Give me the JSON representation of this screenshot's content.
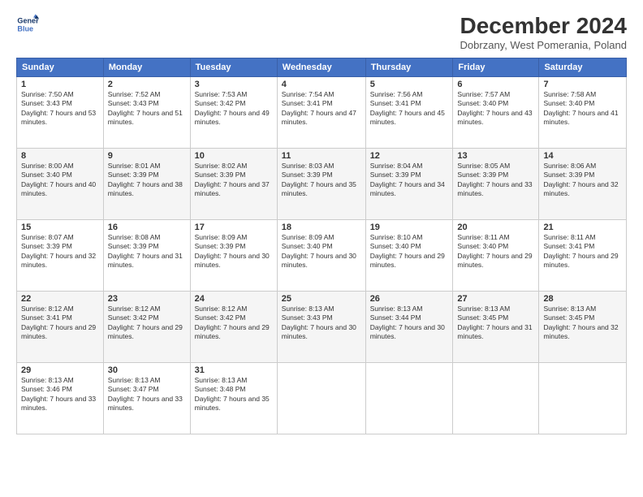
{
  "header": {
    "logo_line1": "General",
    "logo_line2": "Blue",
    "title": "December 2024",
    "subtitle": "Dobrzany, West Pomerania, Poland"
  },
  "columns": [
    "Sunday",
    "Monday",
    "Tuesday",
    "Wednesday",
    "Thursday",
    "Friday",
    "Saturday"
  ],
  "weeks": [
    [
      {
        "day": "1",
        "sunrise": "Sunrise: 7:50 AM",
        "sunset": "Sunset: 3:43 PM",
        "daylight": "Daylight: 7 hours and 53 minutes."
      },
      {
        "day": "2",
        "sunrise": "Sunrise: 7:52 AM",
        "sunset": "Sunset: 3:43 PM",
        "daylight": "Daylight: 7 hours and 51 minutes."
      },
      {
        "day": "3",
        "sunrise": "Sunrise: 7:53 AM",
        "sunset": "Sunset: 3:42 PM",
        "daylight": "Daylight: 7 hours and 49 minutes."
      },
      {
        "day": "4",
        "sunrise": "Sunrise: 7:54 AM",
        "sunset": "Sunset: 3:41 PM",
        "daylight": "Daylight: 7 hours and 47 minutes."
      },
      {
        "day": "5",
        "sunrise": "Sunrise: 7:56 AM",
        "sunset": "Sunset: 3:41 PM",
        "daylight": "Daylight: 7 hours and 45 minutes."
      },
      {
        "day": "6",
        "sunrise": "Sunrise: 7:57 AM",
        "sunset": "Sunset: 3:40 PM",
        "daylight": "Daylight: 7 hours and 43 minutes."
      },
      {
        "day": "7",
        "sunrise": "Sunrise: 7:58 AM",
        "sunset": "Sunset: 3:40 PM",
        "daylight": "Daylight: 7 hours and 41 minutes."
      }
    ],
    [
      {
        "day": "8",
        "sunrise": "Sunrise: 8:00 AM",
        "sunset": "Sunset: 3:40 PM",
        "daylight": "Daylight: 7 hours and 40 minutes."
      },
      {
        "day": "9",
        "sunrise": "Sunrise: 8:01 AM",
        "sunset": "Sunset: 3:39 PM",
        "daylight": "Daylight: 7 hours and 38 minutes."
      },
      {
        "day": "10",
        "sunrise": "Sunrise: 8:02 AM",
        "sunset": "Sunset: 3:39 PM",
        "daylight": "Daylight: 7 hours and 37 minutes."
      },
      {
        "day": "11",
        "sunrise": "Sunrise: 8:03 AM",
        "sunset": "Sunset: 3:39 PM",
        "daylight": "Daylight: 7 hours and 35 minutes."
      },
      {
        "day": "12",
        "sunrise": "Sunrise: 8:04 AM",
        "sunset": "Sunset: 3:39 PM",
        "daylight": "Daylight: 7 hours and 34 minutes."
      },
      {
        "day": "13",
        "sunrise": "Sunrise: 8:05 AM",
        "sunset": "Sunset: 3:39 PM",
        "daylight": "Daylight: 7 hours and 33 minutes."
      },
      {
        "day": "14",
        "sunrise": "Sunrise: 8:06 AM",
        "sunset": "Sunset: 3:39 PM",
        "daylight": "Daylight: 7 hours and 32 minutes."
      }
    ],
    [
      {
        "day": "15",
        "sunrise": "Sunrise: 8:07 AM",
        "sunset": "Sunset: 3:39 PM",
        "daylight": "Daylight: 7 hours and 32 minutes."
      },
      {
        "day": "16",
        "sunrise": "Sunrise: 8:08 AM",
        "sunset": "Sunset: 3:39 PM",
        "daylight": "Daylight: 7 hours and 31 minutes."
      },
      {
        "day": "17",
        "sunrise": "Sunrise: 8:09 AM",
        "sunset": "Sunset: 3:39 PM",
        "daylight": "Daylight: 7 hours and 30 minutes."
      },
      {
        "day": "18",
        "sunrise": "Sunrise: 8:09 AM",
        "sunset": "Sunset: 3:40 PM",
        "daylight": "Daylight: 7 hours and 30 minutes."
      },
      {
        "day": "19",
        "sunrise": "Sunrise: 8:10 AM",
        "sunset": "Sunset: 3:40 PM",
        "daylight": "Daylight: 7 hours and 29 minutes."
      },
      {
        "day": "20",
        "sunrise": "Sunrise: 8:11 AM",
        "sunset": "Sunset: 3:40 PM",
        "daylight": "Daylight: 7 hours and 29 minutes."
      },
      {
        "day": "21",
        "sunrise": "Sunrise: 8:11 AM",
        "sunset": "Sunset: 3:41 PM",
        "daylight": "Daylight: 7 hours and 29 minutes."
      }
    ],
    [
      {
        "day": "22",
        "sunrise": "Sunrise: 8:12 AM",
        "sunset": "Sunset: 3:41 PM",
        "daylight": "Daylight: 7 hours and 29 minutes."
      },
      {
        "day": "23",
        "sunrise": "Sunrise: 8:12 AM",
        "sunset": "Sunset: 3:42 PM",
        "daylight": "Daylight: 7 hours and 29 minutes."
      },
      {
        "day": "24",
        "sunrise": "Sunrise: 8:12 AM",
        "sunset": "Sunset: 3:42 PM",
        "daylight": "Daylight: 7 hours and 29 minutes."
      },
      {
        "day": "25",
        "sunrise": "Sunrise: 8:13 AM",
        "sunset": "Sunset: 3:43 PM",
        "daylight": "Daylight: 7 hours and 30 minutes."
      },
      {
        "day": "26",
        "sunrise": "Sunrise: 8:13 AM",
        "sunset": "Sunset: 3:44 PM",
        "daylight": "Daylight: 7 hours and 30 minutes."
      },
      {
        "day": "27",
        "sunrise": "Sunrise: 8:13 AM",
        "sunset": "Sunset: 3:45 PM",
        "daylight": "Daylight: 7 hours and 31 minutes."
      },
      {
        "day": "28",
        "sunrise": "Sunrise: 8:13 AM",
        "sunset": "Sunset: 3:45 PM",
        "daylight": "Daylight: 7 hours and 32 minutes."
      }
    ],
    [
      {
        "day": "29",
        "sunrise": "Sunrise: 8:13 AM",
        "sunset": "Sunset: 3:46 PM",
        "daylight": "Daylight: 7 hours and 33 minutes."
      },
      {
        "day": "30",
        "sunrise": "Sunrise: 8:13 AM",
        "sunset": "Sunset: 3:47 PM",
        "daylight": "Daylight: 7 hours and 33 minutes."
      },
      {
        "day": "31",
        "sunrise": "Sunrise: 8:13 AM",
        "sunset": "Sunset: 3:48 PM",
        "daylight": "Daylight: 7 hours and 35 minutes."
      },
      null,
      null,
      null,
      null
    ]
  ]
}
